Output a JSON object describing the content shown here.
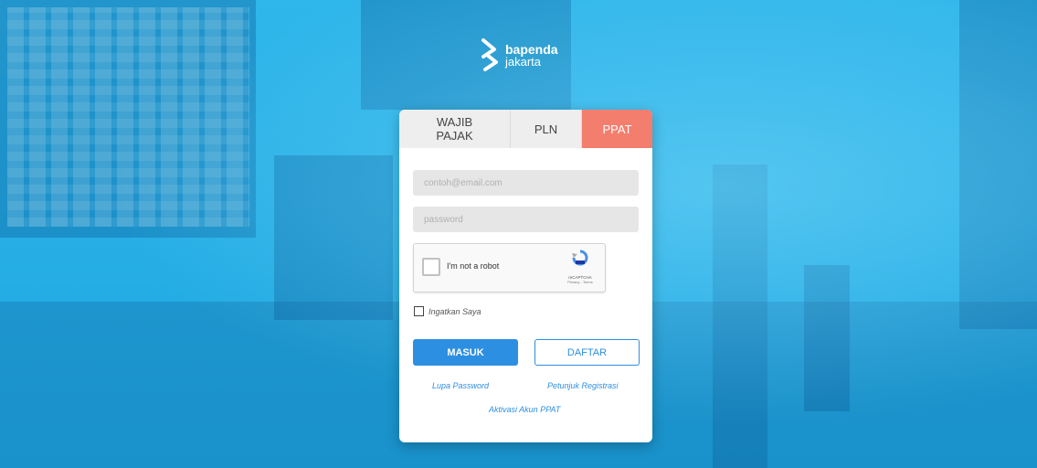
{
  "brand": {
    "line1": "bapenda",
    "line2": "jakarta"
  },
  "tabs": [
    {
      "label": "WAJIB PAJAK",
      "active": false
    },
    {
      "label": "PLN",
      "active": false
    },
    {
      "label": "PPAT",
      "active": true
    }
  ],
  "form": {
    "email_placeholder": "contoh@email.com",
    "password_placeholder": "password",
    "captcha": {
      "label": "I'm not a robot",
      "brand": "reCAPTCHA",
      "links": "Privacy - Terms"
    },
    "remember_label": "Ingatkan Saya",
    "login_label": "MASUK",
    "register_label": "DAFTAR",
    "forgot_link": "Lupa Password",
    "register_guide_link": "Petunjuk Registrasi",
    "activation_link": "Aktivasi Akun PPAT"
  },
  "colors": {
    "background": "#1ea7e0",
    "active_tab": "#f47e6e",
    "primary": "#2d8fe1"
  }
}
